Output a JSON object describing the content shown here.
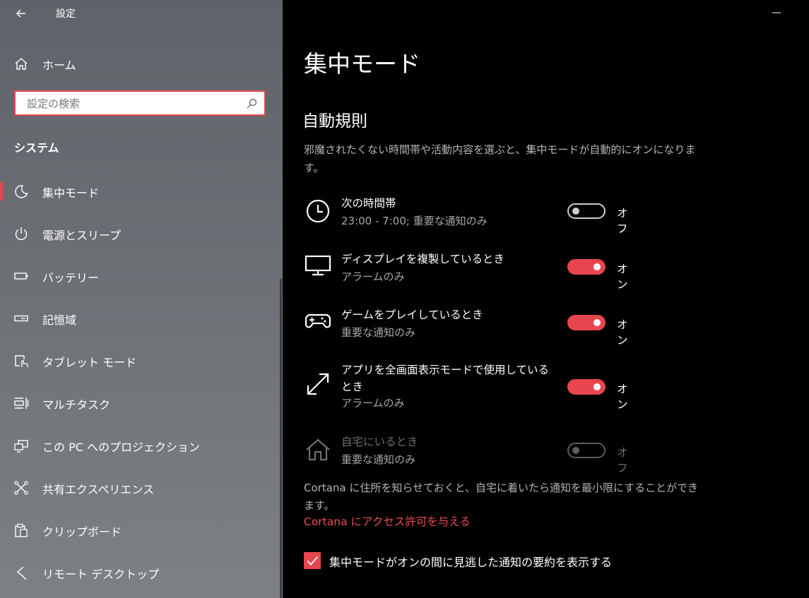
{
  "window": {
    "title": "設定"
  },
  "sidebar": {
    "home_label": "ホーム",
    "search_placeholder": "設定の検索",
    "section_title": "システム",
    "items": [
      {
        "label": "集中モード",
        "icon": "moon-icon",
        "active": true
      },
      {
        "label": "電源とスリープ",
        "icon": "power-icon"
      },
      {
        "label": "バッテリー",
        "icon": "battery-icon"
      },
      {
        "label": "記憶域",
        "icon": "storage-icon"
      },
      {
        "label": "タブレット モード",
        "icon": "tablet-mode-icon"
      },
      {
        "label": "マルチタスク",
        "icon": "multitasking-icon"
      },
      {
        "label": "この PC へのプロジェクション",
        "icon": "projection-icon"
      },
      {
        "label": "共有エクスペリエンス",
        "icon": "shared-experiences-icon"
      },
      {
        "label": "クリップボード",
        "icon": "clipboard-icon"
      },
      {
        "label": "リモート デスクトップ",
        "icon": "remote-desktop-icon"
      }
    ]
  },
  "main": {
    "page_title": "集中モード",
    "section_title": "自動規則",
    "description": "邪魔されたくない時間帯や活動内容を選ぶと、集中モードが自動的にオンになります。",
    "rules": [
      {
        "name": "次の時間帯",
        "detail": "23:00 - 7:00; 重要な通知のみ",
        "state": "オフ",
        "on": false,
        "icon": "clock-icon"
      },
      {
        "name": "ディスプレイを複製しているとき",
        "detail": "アラームのみ",
        "state": "オン",
        "on": true,
        "icon": "monitor-icon"
      },
      {
        "name": "ゲームをプレイしているとき",
        "detail": "重要な通知のみ",
        "state": "オン",
        "on": true,
        "icon": "gamepad-icon"
      },
      {
        "name": "アプリを全画面表示モードで使用しているとき",
        "detail": "アラームのみ",
        "state": "オン",
        "on": true,
        "icon": "fullscreen-icon"
      },
      {
        "name": "自宅にいるとき",
        "detail": "重要な通知のみ",
        "state": "オフ",
        "on": false,
        "disabled": true,
        "icon": "home-icon"
      }
    ],
    "cortana_note": "Cortana に住所を知らせておくと、自宅に着いたら通知を最小限にすることができます。",
    "cortana_link": "Cortana にアクセス許可を与える",
    "summary_checkbox_label": "集中モードがオンの間に見逃した通知の要約を表示する",
    "summary_checked": true
  },
  "colors": {
    "accent": "#e8464f",
    "background": "#000000",
    "sidebar": "#6b6f74"
  }
}
